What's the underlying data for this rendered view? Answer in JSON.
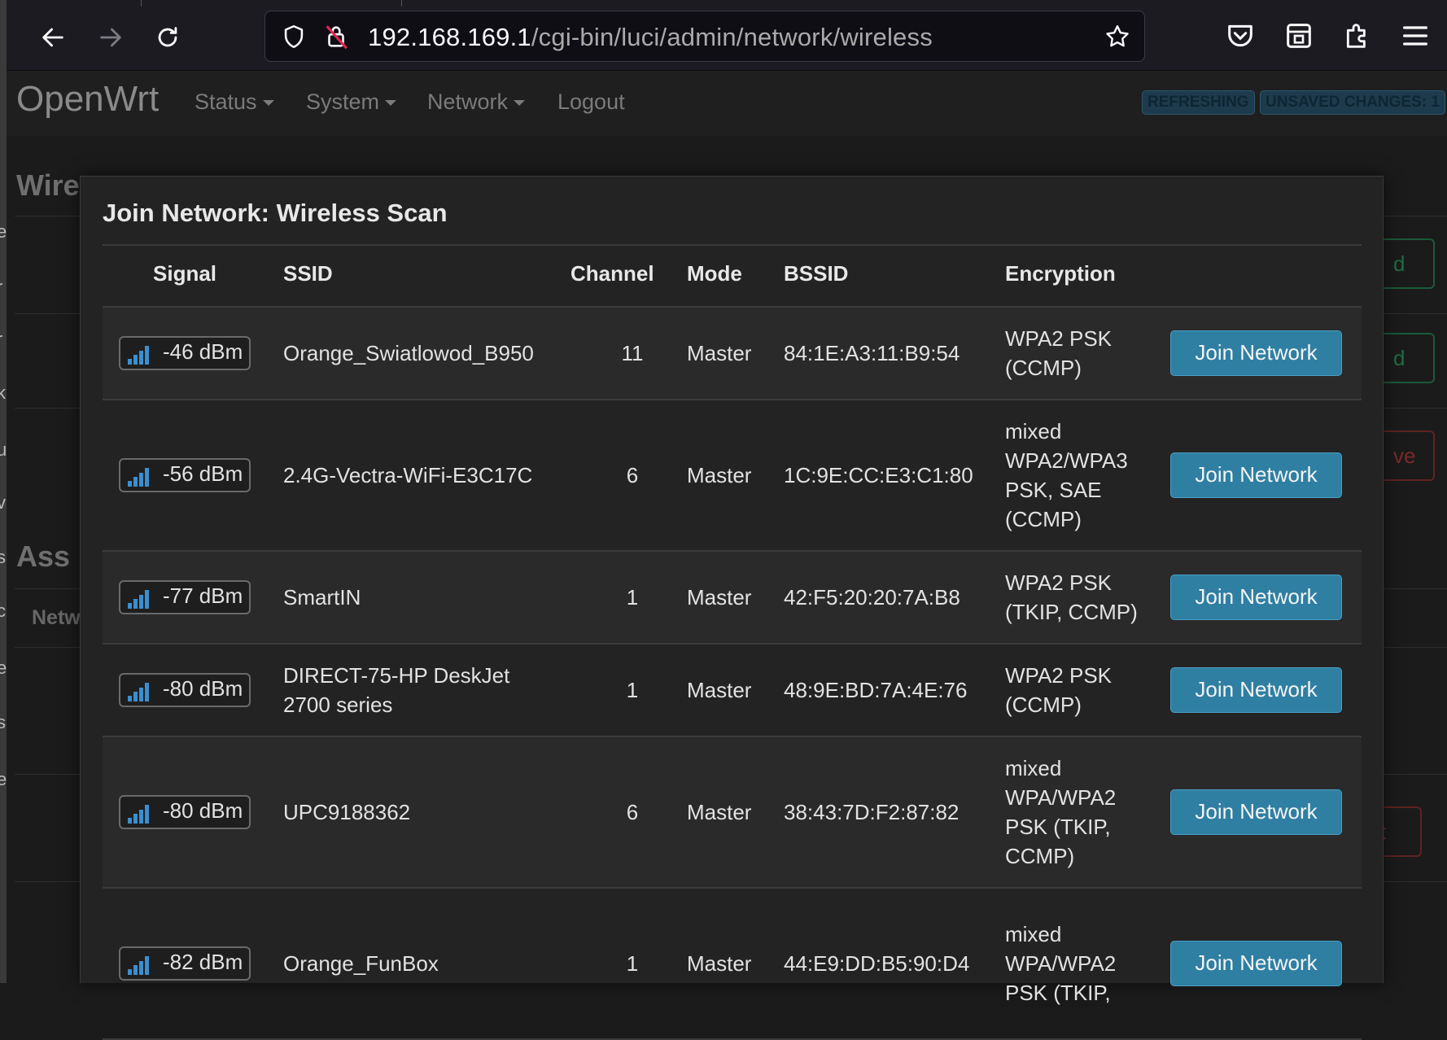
{
  "browser": {
    "url_host": "192.168.169.1",
    "url_path": "/cgi-bin/luci/admin/network/wireless"
  },
  "header": {
    "brand": "OpenWrt",
    "menu": [
      {
        "label": "Status",
        "has_dropdown": true
      },
      {
        "label": "System",
        "has_dropdown": true
      },
      {
        "label": "Network",
        "has_dropdown": true
      },
      {
        "label": "Logout",
        "has_dropdown": false
      }
    ],
    "badges": {
      "refreshing": "REFRESHING",
      "unsaved": "UNSAVED CHANGES: 1"
    }
  },
  "background": {
    "heading_wireless": "Wire",
    "heading_associated": "Ass",
    "label_network": "Netw",
    "button_fragments": [
      "d",
      "d",
      "ve",
      "t"
    ],
    "left_glyphs": [
      "e",
      "r",
      "r",
      "k",
      "u",
      "v",
      "s",
      "c",
      "e",
      "s",
      "e"
    ]
  },
  "modal": {
    "title": "Join Network: Wireless Scan",
    "columns": {
      "signal": "Signal",
      "ssid": "SSID",
      "channel": "Channel",
      "mode": "Mode",
      "bssid": "BSSID",
      "encryption": "Encryption"
    },
    "join_label": "Join Network",
    "rows": [
      {
        "signal": "-46 dBm",
        "ssid": [
          "Orange_Swiatlowod_B950"
        ],
        "channel": "11",
        "mode": "Master",
        "bssid": "84:1E:A3:11:B9:54",
        "encryption": [
          "WPA2 PSK",
          "(CCMP)"
        ]
      },
      {
        "signal": "-56 dBm",
        "ssid": [
          "2.4G-Vectra-WiFi-E3C17C"
        ],
        "channel": "6",
        "mode": "Master",
        "bssid": "1C:9E:CC:E3:C1:80",
        "encryption": [
          "mixed",
          "WPA2/WPA3",
          "PSK, SAE",
          "(CCMP)"
        ]
      },
      {
        "signal": "-77 dBm",
        "ssid": [
          "SmartIN"
        ],
        "channel": "1",
        "mode": "Master",
        "bssid": "42:F5:20:20:7A:B8",
        "encryption": [
          "WPA2 PSK",
          "(TKIP, CCMP)"
        ]
      },
      {
        "signal": "-80 dBm",
        "ssid": [
          "DIRECT-75-HP DeskJet",
          "2700 series"
        ],
        "channel": "1",
        "mode": "Master",
        "bssid": "48:9E:BD:7A:4E:76",
        "encryption": [
          "WPA2 PSK",
          "(CCMP)"
        ]
      },
      {
        "signal": "-80 dBm",
        "ssid": [
          "UPC9188362"
        ],
        "channel": "6",
        "mode": "Master",
        "bssid": "38:43:7D:F2:87:82",
        "encryption": [
          "mixed",
          "WPA/WPA2",
          "PSK (TKIP,",
          "CCMP)"
        ]
      },
      {
        "signal": "-82 dBm",
        "ssid": [
          "Orange_FunBox"
        ],
        "channel": "1",
        "mode": "Master",
        "bssid": "44:E9:DD:B5:90:D4",
        "encryption": [
          "mixed",
          "WPA/WPA2",
          "PSK (TKIP,"
        ]
      }
    ]
  },
  "icons": {
    "back": "arrow-left-icon",
    "forward": "arrow-right-icon",
    "reload": "reload-icon",
    "shield": "shield-icon",
    "insecure": "insecure-lock-icon",
    "bookmark": "star-icon",
    "pocket": "pocket-icon",
    "container": "container-icon",
    "extensions": "puzzle-icon",
    "menu": "hamburger-icon",
    "signal": "signal-bars-icon"
  },
  "colors": {
    "accent": "#2f7fa3",
    "background": "#1b1b1b",
    "modal": "#232323"
  }
}
